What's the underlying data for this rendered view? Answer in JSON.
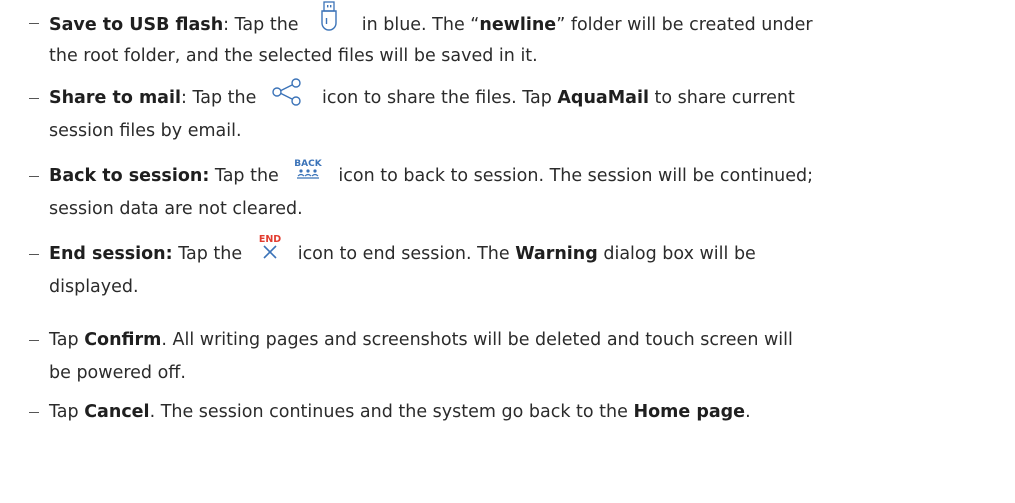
{
  "items": [
    {
      "id": "usb",
      "lead": "Save to USB flash",
      "lead_punct": ":",
      "pre_icon": " Tap the",
      "icon": "usb-flash-icon",
      "post_icon": " in blue. The “",
      "bold2": "newline",
      "post_bold2": "” folder will be created under",
      "line2": "the root folder, and the selected files will be saved in it."
    },
    {
      "id": "share",
      "lead": "Share to mail",
      "lead_punct": ":",
      "pre_icon": " Tap the",
      "icon": "share-icon",
      "post_icon": "icon to share the files. Tap ",
      "bold2": "AquaMail",
      "post_bold2": " to share current",
      "line2": "session files by email."
    },
    {
      "id": "back",
      "lead": "Back to session:",
      "pre_icon": " Tap the",
      "icon": "back-session-icon",
      "icon_text": "BACK",
      "post_icon": "icon to back to session. The session will be continued;",
      "line2": "session data are not cleared."
    },
    {
      "id": "end",
      "lead": "End session:",
      "pre_icon": " Tap the",
      "icon": "end-session-icon",
      "icon_text": "END",
      "post_icon": "icon to end session. The ",
      "bold2": "Warning",
      "post_bold2": " dialog box will be",
      "line2": "displayed."
    },
    {
      "id": "confirm",
      "pre": "Tap ",
      "bold1": "Confirm",
      "post": ". All writing pages and screenshots will be deleted and touch screen will",
      "line2": "be powered off."
    },
    {
      "id": "cancel",
      "pre": "Tap ",
      "bold1": "Cancel",
      "post": ". The session continues and the system go back to the ",
      "bold2": "Home page",
      "post2": "."
    }
  ],
  "colors": {
    "icon_blue": "#3b73b8",
    "end_red": "#e23b2e"
  }
}
